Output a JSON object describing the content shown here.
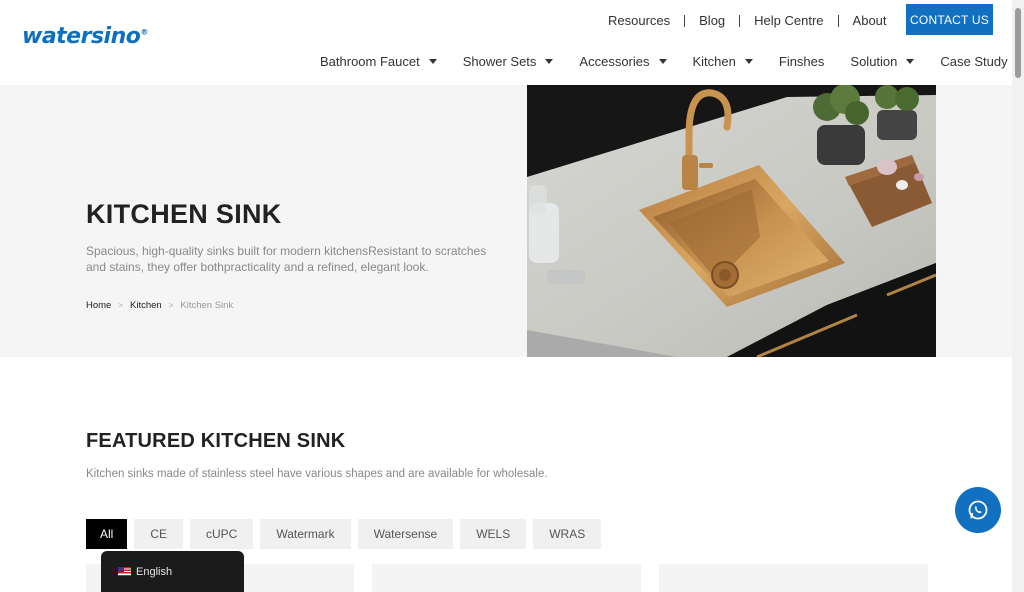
{
  "brand": {
    "logo_text": "watersino",
    "reg_mark": "®",
    "color": "#0f6fbd"
  },
  "top_links": [
    "Resources",
    "Blog",
    "Help Centre",
    "About"
  ],
  "contact_button": "CONTACT US",
  "main_nav": [
    {
      "label": "Bathroom Faucet",
      "dropdown": true
    },
    {
      "label": "Shower Sets",
      "dropdown": true
    },
    {
      "label": "Accessories",
      "dropdown": true
    },
    {
      "label": "Kitchen",
      "dropdown": true
    },
    {
      "label": "Finshes",
      "dropdown": false
    },
    {
      "label": "Solution",
      "dropdown": true
    },
    {
      "label": "Case Study",
      "dropdown": false
    }
  ],
  "hero": {
    "title": "KITCHEN SINK",
    "description": "Spacious, high-quality sinks built for modern kitchensResistant to scratches and stains, they offer bothpracticality and a refined, elegant look.",
    "breadcrumb": {
      "home": "Home",
      "parent": "Kitchen",
      "current": "Kitchen Sink",
      "separator": ">"
    }
  },
  "featured": {
    "title": "FEATURED KITCHEN SINK",
    "description": "Kitchen sinks made of stainless steel have various shapes and are available for wholesale.",
    "filters": [
      "All",
      "CE",
      "cUPC",
      "Watermark",
      "Watersense",
      "WELS",
      "WRAS"
    ],
    "active_filter": "All"
  },
  "language": {
    "label": "English",
    "flag_icon": "us-flag-icon"
  },
  "colors": {
    "accent": "#1170c0",
    "hero_bg": "#f5f5f5",
    "text_muted": "#888888"
  },
  "icons": {
    "whatsapp": "whatsapp-icon",
    "caret": "caret-down-icon"
  }
}
